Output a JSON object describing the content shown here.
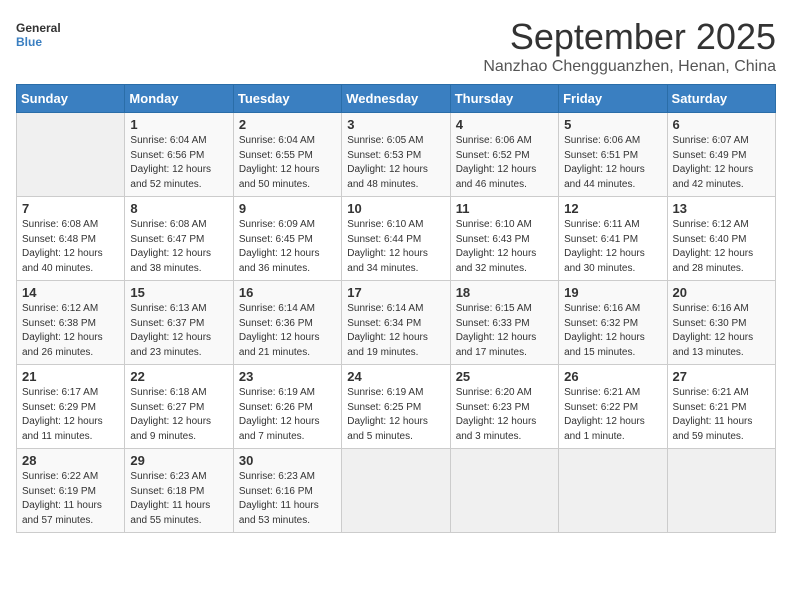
{
  "header": {
    "logo_general": "General",
    "logo_blue": "Blue",
    "month": "September 2025",
    "location": "Nanzhao Chengguanzhen, Henan, China"
  },
  "weekdays": [
    "Sunday",
    "Monday",
    "Tuesday",
    "Wednesday",
    "Thursday",
    "Friday",
    "Saturday"
  ],
  "weeks": [
    [
      {
        "day": "",
        "empty": true
      },
      {
        "day": "1",
        "sunrise": "6:04 AM",
        "sunset": "6:56 PM",
        "daylight": "12 hours and 52 minutes."
      },
      {
        "day": "2",
        "sunrise": "6:04 AM",
        "sunset": "6:55 PM",
        "daylight": "12 hours and 50 minutes."
      },
      {
        "day": "3",
        "sunrise": "6:05 AM",
        "sunset": "6:53 PM",
        "daylight": "12 hours and 48 minutes."
      },
      {
        "day": "4",
        "sunrise": "6:06 AM",
        "sunset": "6:52 PM",
        "daylight": "12 hours and 46 minutes."
      },
      {
        "day": "5",
        "sunrise": "6:06 AM",
        "sunset": "6:51 PM",
        "daylight": "12 hours and 44 minutes."
      },
      {
        "day": "6",
        "sunrise": "6:07 AM",
        "sunset": "6:49 PM",
        "daylight": "12 hours and 42 minutes."
      }
    ],
    [
      {
        "day": "7",
        "sunrise": "6:08 AM",
        "sunset": "6:48 PM",
        "daylight": "12 hours and 40 minutes."
      },
      {
        "day": "8",
        "sunrise": "6:08 AM",
        "sunset": "6:47 PM",
        "daylight": "12 hours and 38 minutes."
      },
      {
        "day": "9",
        "sunrise": "6:09 AM",
        "sunset": "6:45 PM",
        "daylight": "12 hours and 36 minutes."
      },
      {
        "day": "10",
        "sunrise": "6:10 AM",
        "sunset": "6:44 PM",
        "daylight": "12 hours and 34 minutes."
      },
      {
        "day": "11",
        "sunrise": "6:10 AM",
        "sunset": "6:43 PM",
        "daylight": "12 hours and 32 minutes."
      },
      {
        "day": "12",
        "sunrise": "6:11 AM",
        "sunset": "6:41 PM",
        "daylight": "12 hours and 30 minutes."
      },
      {
        "day": "13",
        "sunrise": "6:12 AM",
        "sunset": "6:40 PM",
        "daylight": "12 hours and 28 minutes."
      }
    ],
    [
      {
        "day": "14",
        "sunrise": "6:12 AM",
        "sunset": "6:38 PM",
        "daylight": "12 hours and 26 minutes."
      },
      {
        "day": "15",
        "sunrise": "6:13 AM",
        "sunset": "6:37 PM",
        "daylight": "12 hours and 23 minutes."
      },
      {
        "day": "16",
        "sunrise": "6:14 AM",
        "sunset": "6:36 PM",
        "daylight": "12 hours and 21 minutes."
      },
      {
        "day": "17",
        "sunrise": "6:14 AM",
        "sunset": "6:34 PM",
        "daylight": "12 hours and 19 minutes."
      },
      {
        "day": "18",
        "sunrise": "6:15 AM",
        "sunset": "6:33 PM",
        "daylight": "12 hours and 17 minutes."
      },
      {
        "day": "19",
        "sunrise": "6:16 AM",
        "sunset": "6:32 PM",
        "daylight": "12 hours and 15 minutes."
      },
      {
        "day": "20",
        "sunrise": "6:16 AM",
        "sunset": "6:30 PM",
        "daylight": "12 hours and 13 minutes."
      }
    ],
    [
      {
        "day": "21",
        "sunrise": "6:17 AM",
        "sunset": "6:29 PM",
        "daylight": "12 hours and 11 minutes."
      },
      {
        "day": "22",
        "sunrise": "6:18 AM",
        "sunset": "6:27 PM",
        "daylight": "12 hours and 9 minutes."
      },
      {
        "day": "23",
        "sunrise": "6:19 AM",
        "sunset": "6:26 PM",
        "daylight": "12 hours and 7 minutes."
      },
      {
        "day": "24",
        "sunrise": "6:19 AM",
        "sunset": "6:25 PM",
        "daylight": "12 hours and 5 minutes."
      },
      {
        "day": "25",
        "sunrise": "6:20 AM",
        "sunset": "6:23 PM",
        "daylight": "12 hours and 3 minutes."
      },
      {
        "day": "26",
        "sunrise": "6:21 AM",
        "sunset": "6:22 PM",
        "daylight": "12 hours and 1 minute."
      },
      {
        "day": "27",
        "sunrise": "6:21 AM",
        "sunset": "6:21 PM",
        "daylight": "11 hours and 59 minutes."
      }
    ],
    [
      {
        "day": "28",
        "sunrise": "6:22 AM",
        "sunset": "6:19 PM",
        "daylight": "11 hours and 57 minutes."
      },
      {
        "day": "29",
        "sunrise": "6:23 AM",
        "sunset": "6:18 PM",
        "daylight": "11 hours and 55 minutes."
      },
      {
        "day": "30",
        "sunrise": "6:23 AM",
        "sunset": "6:16 PM",
        "daylight": "11 hours and 53 minutes."
      },
      {
        "day": "",
        "empty": true
      },
      {
        "day": "",
        "empty": true
      },
      {
        "day": "",
        "empty": true
      },
      {
        "day": "",
        "empty": true
      }
    ]
  ],
  "labels": {
    "sunrise": "Sunrise:",
    "sunset": "Sunset:",
    "daylight": "Daylight:"
  }
}
